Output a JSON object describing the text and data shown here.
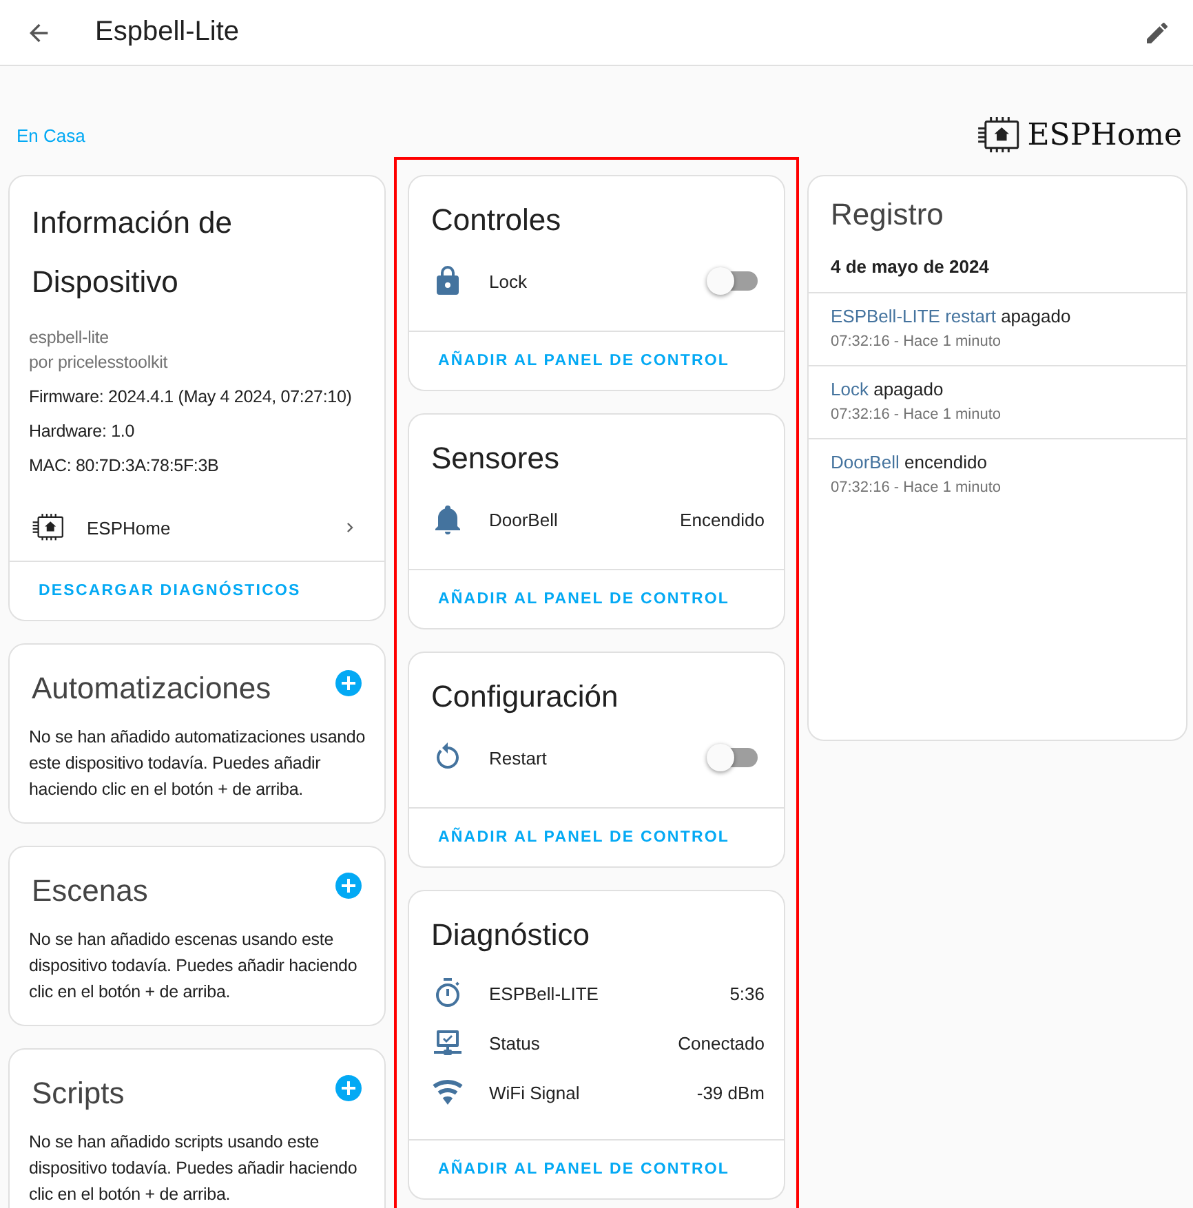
{
  "header": {
    "title": "Espbell-Lite"
  },
  "area_link": "En Casa",
  "brand": {
    "name": "ESPHome"
  },
  "device_info": {
    "title": "Información de Dispositivo",
    "model": "espbell-lite",
    "manufacturer": "por pricelesstoolkit",
    "details": [
      "Firmware: 2024.4.1 (May 4 2024, 07:27:10)",
      "Hardware: 1.0",
      "MAC: 80:7D:3A:78:5F:3B"
    ],
    "integration": "ESPHome",
    "action": "DESCARGAR DIAGNÓSTICOS"
  },
  "related_cards": [
    {
      "title": "Automatizaciones",
      "text": "No se han añadido automatizaciones usando este dispositivo todavía. Puedes añadir haciendo clic en el botón + de arriba."
    },
    {
      "title": "Escenas",
      "text": "No se han añadido escenas usando este dispositivo todavía. Puedes añadir haciendo clic en el botón + de arriba."
    },
    {
      "title": "Scripts",
      "text": "No se han añadido scripts usando este dispositivo todavía. Puedes añadir haciendo clic en el botón + de arriba."
    }
  ],
  "entity_column": {
    "highlighted": true,
    "cards": [
      {
        "title": "Controles",
        "entities": [
          {
            "name": "Lock",
            "kind": "toggle",
            "on": false
          }
        ],
        "action": "AÑADIR AL PANEL DE CONTROL"
      },
      {
        "title": "Sensores",
        "entities": [
          {
            "name": "DoorBell",
            "kind": "state",
            "value": "Encendido"
          }
        ],
        "action": "AÑADIR AL PANEL DE CONTROL"
      },
      {
        "title": "Configuración",
        "entities": [
          {
            "name": "Restart",
            "kind": "toggle",
            "on": false
          }
        ],
        "action": "AÑADIR AL PANEL DE CONTROL"
      },
      {
        "title": "Diagnóstico",
        "entities": [
          {
            "name": "ESPBell-LITE",
            "kind": "state",
            "value": "5:36"
          },
          {
            "name": "Status",
            "kind": "state",
            "value": "Conectado"
          },
          {
            "name": "WiFi Signal",
            "kind": "state",
            "value": "-39 dBm"
          }
        ],
        "action": "AÑADIR AL PANEL DE CONTROL"
      }
    ]
  },
  "logbook": {
    "title": "Registro",
    "date": "4 de mayo de 2024",
    "entries": [
      {
        "entity": "ESPBell-LITE restart",
        "state": "apagado",
        "time": "07:32:16 - Hace 1 minuto"
      },
      {
        "entity": "Lock",
        "state": "apagado",
        "time": "07:32:16 - Hace 1 minuto"
      },
      {
        "entity": "DoorBell",
        "state": "encendido",
        "time": "07:32:16 - Hace 1 minuto"
      }
    ]
  }
}
